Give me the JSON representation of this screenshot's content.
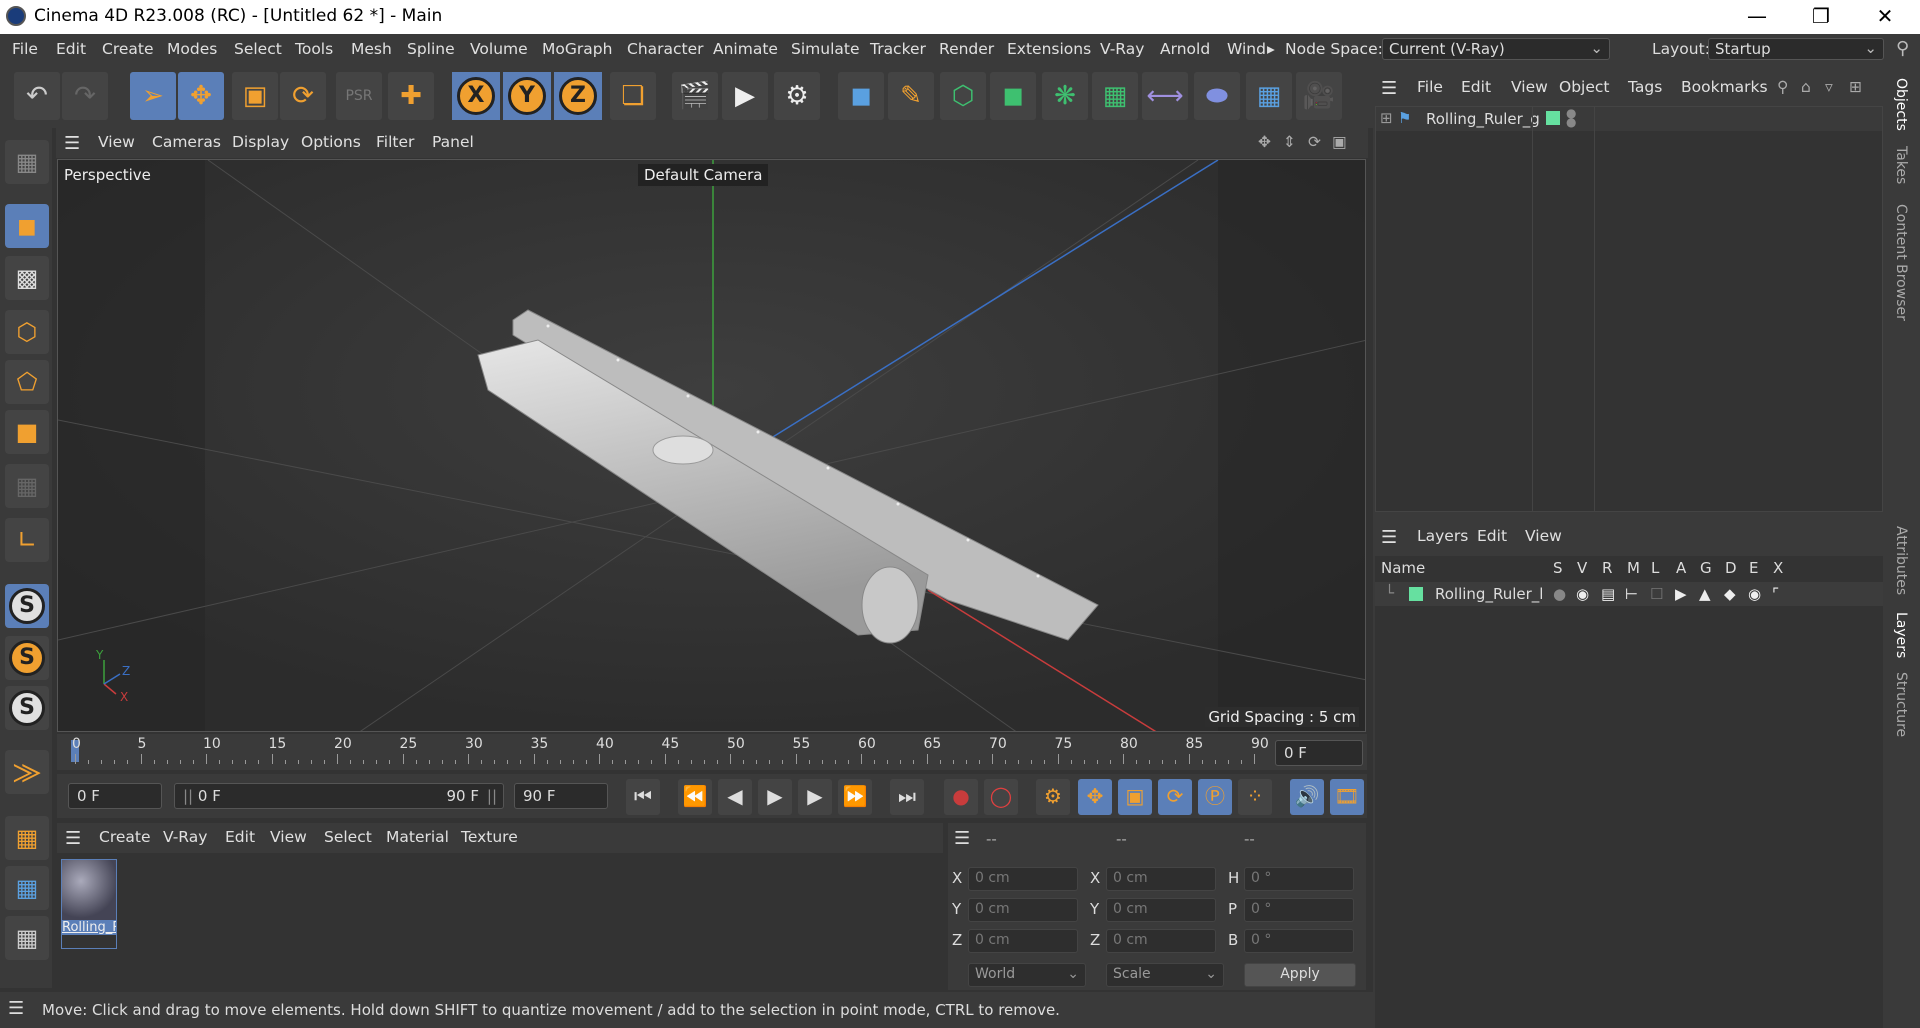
{
  "window": {
    "title": "Cinema 4D R23.008 (RC) - [Untitled 62 *] - Main"
  },
  "menu": [
    "File",
    "Edit",
    "Create",
    "Modes",
    "Select",
    "Tools",
    "Mesh",
    "Spline",
    "Volume",
    "MoGraph",
    "Character",
    "Animate",
    "Simulate",
    "Tracker",
    "Render",
    "Extensions",
    "V-Ray",
    "Arnold",
    "Wind"
  ],
  "node_space": {
    "label": "Node Space:",
    "value": "Current (V-Ray)"
  },
  "layout": {
    "label": "Layout:",
    "value": "Startup"
  },
  "axes": [
    "X",
    "Y",
    "Z"
  ],
  "viewport_menu": [
    "View",
    "Cameras",
    "Display",
    "Options",
    "Filter",
    "Panel"
  ],
  "viewport": {
    "name": "Perspective",
    "camera": "Default Camera",
    "grid_spacing": "Grid Spacing : 5 cm",
    "axis_x": "X",
    "axis_y": "Y",
    "axis_z": "Z"
  },
  "timeline": {
    "ticks": [
      "0",
      "5",
      "10",
      "15",
      "20",
      "25",
      "30",
      "35",
      "40",
      "45",
      "50",
      "55",
      "60",
      "65",
      "70",
      "75",
      "80",
      "85",
      "90"
    ],
    "current_frame": "0 F"
  },
  "transport": {
    "start": "0 F",
    "range_start": "0 F",
    "range_end": "90 F",
    "end": "90 F"
  },
  "material_menu": [
    "Create",
    "V-Ray",
    "Edit",
    "View",
    "Select",
    "Material",
    "Texture"
  ],
  "material": {
    "name": "Rolling_R"
  },
  "attributes": {
    "headers": [
      "--",
      "--",
      "--"
    ],
    "labels": [
      "X",
      "Y",
      "Z",
      "X",
      "Y",
      "Z",
      "H",
      "P",
      "B"
    ],
    "values": [
      "0 cm",
      "0 cm",
      "0 cm",
      "0 cm",
      "0 cm",
      "0 cm",
      "0 °",
      "0 °",
      "0 °"
    ],
    "coord": "World",
    "mode": "Scale",
    "apply": "Apply"
  },
  "status": "Move: Click and drag to move elements. Hold down SHIFT to quantize movement / add to the selection in point mode, CTRL to remove.",
  "objects_menu": [
    "File",
    "Edit",
    "View",
    "Object",
    "Tags",
    "Bookmarks"
  ],
  "object": {
    "name": "Rolling_Ruler_g"
  },
  "layers_menu": [
    "Layers",
    "Edit",
    "View"
  ],
  "layers_head": [
    "Name",
    "S",
    "V",
    "R",
    "M",
    "L",
    "A",
    "G",
    "D",
    "E",
    "X"
  ],
  "layer": {
    "name": "Rolling_Ruler_l"
  },
  "side_tabs": [
    "Objects",
    "Takes",
    "Content Browser",
    "Attributes",
    "Layers",
    "Structure"
  ],
  "colors": {
    "accent": "#f0a030",
    "selected": "#5b7fb8",
    "layer_green": "#66e0a0"
  }
}
